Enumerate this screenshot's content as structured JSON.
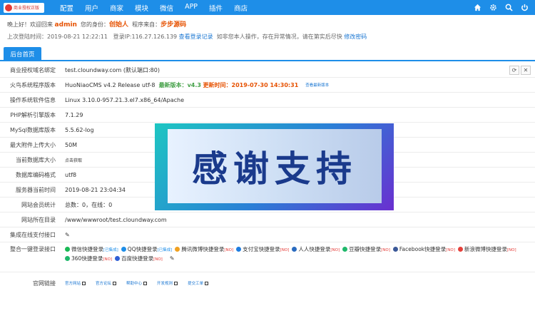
{
  "brand": {
    "logo_text": "商业授权正版"
  },
  "nav": {
    "items": [
      "配置",
      "用户",
      "商家",
      "模块",
      "微信",
      "APP",
      "插件",
      "商店"
    ]
  },
  "nav_icons": [
    "home-icon",
    "gear-icon",
    "search-icon",
    "power-icon"
  ],
  "welcome": {
    "greeting": "晚上好！欢迎回来",
    "username": "admin",
    "identity_label": "您的身份：",
    "identity": "创始人",
    "source_label": "程序来自：",
    "source": "步步源码"
  },
  "login": {
    "last_login_label": "上次登陆时间：",
    "last_login_time": "2019-08-21 12:22:11",
    "ip_label": "登录IP:",
    "ip": "116.27.126.139",
    "view_log_link": "查看登录记录",
    "warning": "如非您本人操作，存在异常情况，请在第实后尽快",
    "change_pwd_link": "修改密码"
  },
  "tabs": {
    "home": "后台首页"
  },
  "rows": {
    "domain": {
      "label": "商业授权域名绑定",
      "value": "test.cloundway.com (默认端口:80)"
    },
    "version": {
      "label": "火鸟系统程序版本",
      "value": "HuoNiaoCMS v4.2 Release utf-8",
      "latest_label": "最新版本：",
      "latest": "v4.3",
      "update_label": "更新时间：",
      "update": "2019-07-30 14:30:31",
      "check_link": "查看最新版本"
    },
    "os": {
      "label": "操作系统软件信息",
      "value": "Linux 3.10.0-957.21.3.el7.x86_64/Apache"
    },
    "php": {
      "label": "PHP解析引擎版本",
      "value": "7.1.29"
    },
    "mysql": {
      "label": "MySql数据库版本",
      "value": "5.5.62-log"
    },
    "upload": {
      "label": "最大附件上传大小",
      "value": "50M"
    },
    "db_size": {
      "label": "当前数据库大小",
      "value": "点击获取"
    },
    "charset": {
      "label": "数据库编码格式",
      "value": "utf8"
    },
    "server_time": {
      "label": "服务器当前时间",
      "value": "2019-08-21 23:04:34"
    },
    "members": {
      "label": "网站会员统计",
      "value": "总数：0，在线：0"
    },
    "dir": {
      "label": "网站所在目录",
      "value": "/www/wwwroot/test.cloundway.com"
    },
    "payment": {
      "label": "集成在线支付接口"
    },
    "quick_login": {
      "label": "整合一键登录接口"
    },
    "official": {
      "label": "官网链接"
    }
  },
  "quick_logins": [
    {
      "name": "微信快捷登录",
      "status": "[已集成]",
      "color": "#19b955"
    },
    {
      "name": "QQ快捷登录",
      "status": "[已集成]",
      "color": "#1e8ee8"
    },
    {
      "name": "腾讯微博快捷登录",
      "status": "[NO]",
      "color": "#f0a020"
    },
    {
      "name": "支付宝快捷登录",
      "status": "[NO]",
      "color": "#1f7de0"
    },
    {
      "name": "人人快捷登录",
      "status": "[NO]",
      "color": "#2a6bbf"
    },
    {
      "name": "豆瓣快捷登录",
      "status": "[NO]",
      "color": "#1fb86b"
    },
    {
      "name": "Facebook快捷登录",
      "status": "[NO]",
      "color": "#3b5998"
    },
    {
      "name": "新浪微博快捷登录",
      "status": "[NO]",
      "color": "#e5403a"
    },
    {
      "name": "360快捷登录",
      "status": "[NO]",
      "color": "#1fb86b"
    },
    {
      "name": "百度快捷登录",
      "status": "[NO]",
      "color": "#2f5fd6"
    }
  ],
  "official_links": [
    "官方网站",
    "官方论坛",
    "帮助中心",
    "开发规则",
    "提交工单"
  ],
  "overlay": {
    "text": "感谢支持"
  }
}
